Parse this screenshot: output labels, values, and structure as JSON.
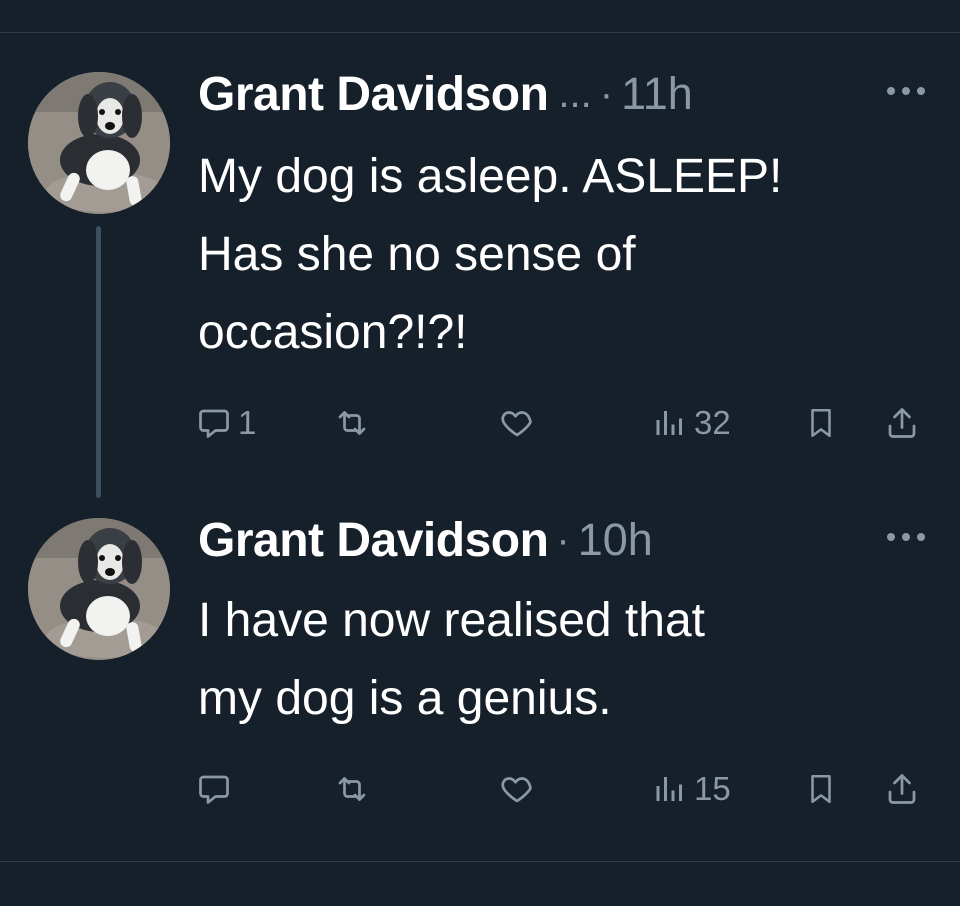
{
  "tweets": [
    {
      "author": "Grant Davidson",
      "handle_truncated": "...",
      "separator": "·",
      "time": "11h",
      "text_lines": [
        "My dog is asleep. ASLEEP!",
        "Has she no sense of",
        "occasion?!?!"
      ],
      "replies": "1",
      "retweets": "",
      "likes": "",
      "views": "32"
    },
    {
      "author": "Grant Davidson",
      "separator": "·",
      "time": "10h",
      "text_lines": [
        "I have now realised that",
        "my dog is a genius."
      ],
      "replies": "",
      "retweets": "",
      "likes": "",
      "views": "15"
    }
  ],
  "icons": {
    "reply": "reply-icon",
    "retweet": "retweet-icon",
    "like": "heart-icon",
    "views": "views-icon",
    "bookmark": "bookmark-icon",
    "share": "share-icon",
    "more": "more-icon"
  },
  "colors": {
    "background": "#15202b",
    "text_primary": "#ffffff",
    "text_secondary": "#8b98a5",
    "thread_line": "#3d4e5e"
  }
}
